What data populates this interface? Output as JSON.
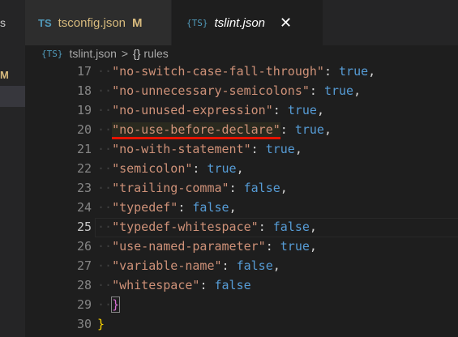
{
  "sidebar": {
    "badge": "M",
    "dots": "s"
  },
  "tabs": [
    {
      "icon": "TS",
      "label": "tsconfig.json",
      "status": "M"
    },
    {
      "icon": "{TS}",
      "label": "tslint.json",
      "close": "✕"
    }
  ],
  "breadcrumb": {
    "icon": "{TS}",
    "file": "tslint.json",
    "sep": ">",
    "braces": "{}",
    "symbol": "rules"
  },
  "editor": {
    "lines": [
      {
        "n": "17",
        "key": "\"no-switch-case-fall-through\"",
        "value": "true",
        "comma": ","
      },
      {
        "n": "18",
        "key": "\"no-unnecessary-semicolons\"",
        "value": "true",
        "comma": ","
      },
      {
        "n": "19",
        "key": "\"no-unused-expression\"",
        "value": "true",
        "comma": ","
      },
      {
        "n": "20",
        "key": "\"no-use-before-declare\"",
        "value": "true",
        "comma": ","
      },
      {
        "n": "21",
        "key": "\"no-with-statement\"",
        "value": "true",
        "comma": ","
      },
      {
        "n": "22",
        "key": "\"semicolon\"",
        "value": "true",
        "comma": ","
      },
      {
        "n": "23",
        "key": "\"trailing-comma\"",
        "value": "false",
        "comma": ","
      },
      {
        "n": "24",
        "key": "\"typedef\"",
        "value": "false",
        "comma": ","
      },
      {
        "n": "25",
        "key": "\"typedef-whitespace\"",
        "value": "false",
        "comma": ","
      },
      {
        "n": "26",
        "key": "\"use-named-parameter\"",
        "value": "true",
        "comma": ","
      },
      {
        "n": "27",
        "key": "\"variable-name\"",
        "value": "false",
        "comma": ","
      },
      {
        "n": "28",
        "key": "\"whitespace\"",
        "value": "false",
        "comma": ""
      }
    ],
    "line29": {
      "n": "29",
      "brace": "}"
    },
    "line30": {
      "n": "30",
      "brace": "}"
    },
    "colon": ": "
  }
}
